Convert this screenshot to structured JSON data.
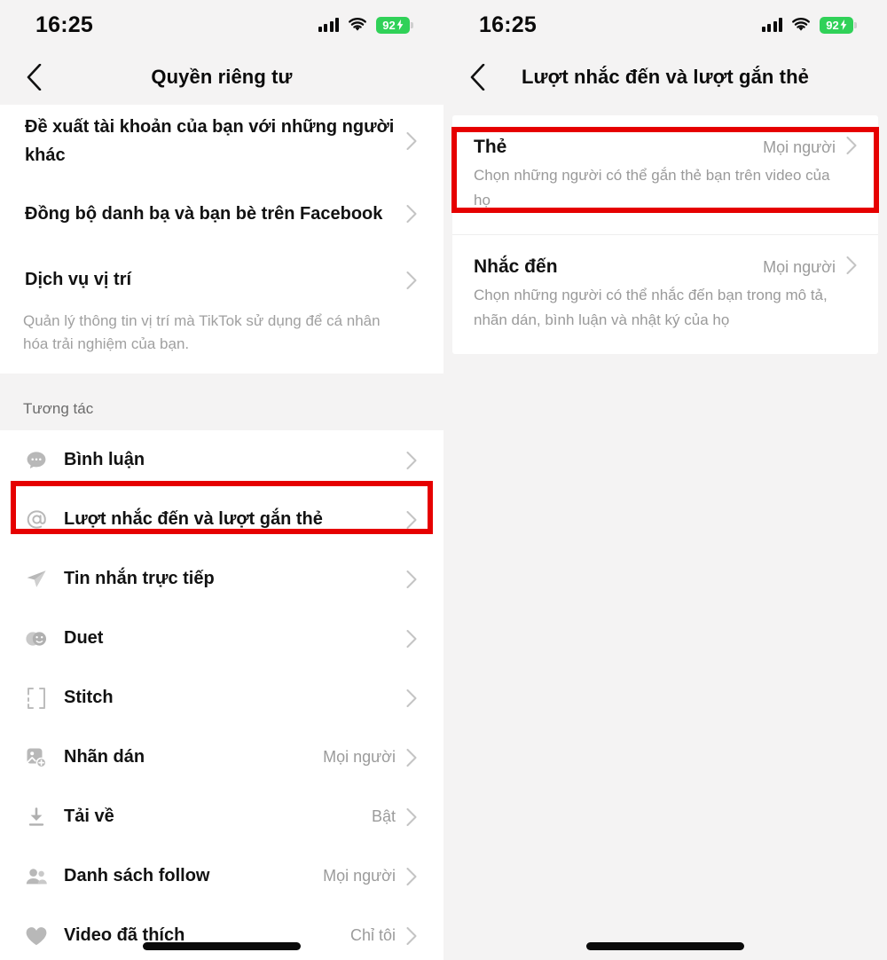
{
  "status_bar": {
    "time": "16:25",
    "battery_percent": "92",
    "battery_color": "#30d158",
    "icons": [
      "cellular-signal-icon",
      "wifi-icon",
      "battery-charging-icon"
    ]
  },
  "highlight_color": "#e60000",
  "left_screen": {
    "nav": {
      "back_icon": "chevron-left-icon",
      "title": "Quyền riêng tư"
    },
    "top_group": [
      {
        "label": "Đề xuất tài khoản của bạn với những người khác",
        "chevron": "chevron-right-icon"
      },
      {
        "label": "Đồng bộ danh bạ và bạn bè trên Facebook",
        "chevron": "chevron-right-icon"
      },
      {
        "label": "Dịch vụ vị trí",
        "chevron": "chevron-right-icon",
        "desc": "Quản lý thông tin vị trí mà TikTok sử dụng để cá nhân hóa trải nghiệm của bạn."
      }
    ],
    "section_label": "Tương tác",
    "interaction_items": [
      {
        "icon": "comment-icon",
        "label": "Bình luận",
        "value": "",
        "highlighted": false
      },
      {
        "icon": "at-mention-icon",
        "label": "Lượt nhắc đến và lượt gắn thẻ",
        "value": "",
        "highlighted": true
      },
      {
        "icon": "send-message-icon",
        "label": "Tin nhắn trực tiếp",
        "value": "",
        "highlighted": false
      },
      {
        "icon": "duet-icon",
        "label": "Duet",
        "value": "",
        "highlighted": false
      },
      {
        "icon": "stitch-icon",
        "label": "Stitch",
        "value": "",
        "highlighted": false
      },
      {
        "icon": "sticker-icon",
        "label": "Nhãn dán",
        "value": "Mọi người",
        "highlighted": false
      },
      {
        "icon": "download-icon",
        "label": "Tải về",
        "value": "Bật",
        "highlighted": false
      },
      {
        "icon": "people-icon",
        "label": "Danh sách follow",
        "value": "Mọi người",
        "highlighted": false
      },
      {
        "icon": "heart-icon",
        "label": "Video đã thích",
        "value": "Chỉ tôi",
        "highlighted": false
      }
    ]
  },
  "right_screen": {
    "nav": {
      "back_icon": "chevron-left-icon",
      "title": "Lượt nhắc đến và lượt gắn thẻ"
    },
    "items": [
      {
        "title": "Thẻ",
        "value": "Mọi người",
        "desc": "Chọn những người có thể gắn thẻ bạn trên video của họ",
        "chevron": "chevron-right-icon",
        "highlighted": true
      },
      {
        "title": "Nhắc đến",
        "value": "Mọi người",
        "desc": "Chọn những người có thể nhắc đến bạn trong mô tả, nhãn dán, bình luận và nhật ký của họ",
        "chevron": "chevron-right-icon",
        "highlighted": false
      }
    ]
  }
}
